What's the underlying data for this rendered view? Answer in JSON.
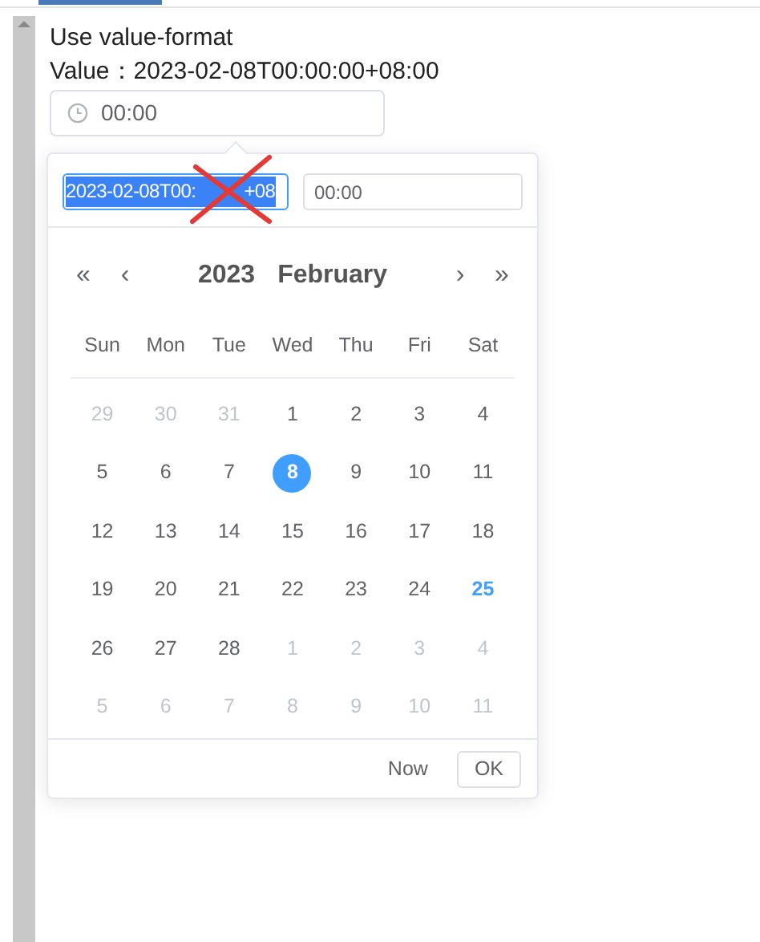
{
  "heading": "Use value-format",
  "value_label": "Value：",
  "value_text": "2023-02-08T00:00:00+08:00",
  "time_input": {
    "value": "00:00"
  },
  "picker": {
    "date_value_start": "2023-02-08T00:",
    "date_value_end": "+08",
    "date_value_selected": true,
    "time_value": "00:00",
    "nav": {
      "prev_year": "«",
      "prev_month": "‹",
      "next_month": "›",
      "next_year": "»"
    },
    "year": "2023",
    "month": "February",
    "weekdays": [
      "Sun",
      "Mon",
      "Tue",
      "Wed",
      "Thu",
      "Fri",
      "Sat"
    ],
    "days": [
      {
        "label": "29",
        "kind": "other",
        "selected": false,
        "today": false
      },
      {
        "label": "30",
        "kind": "other",
        "selected": false,
        "today": false
      },
      {
        "label": "31",
        "kind": "other",
        "selected": false,
        "today": false
      },
      {
        "label": "1",
        "kind": "current",
        "selected": false,
        "today": false
      },
      {
        "label": "2",
        "kind": "current",
        "selected": false,
        "today": false
      },
      {
        "label": "3",
        "kind": "current",
        "selected": false,
        "today": false
      },
      {
        "label": "4",
        "kind": "current",
        "selected": false,
        "today": false
      },
      {
        "label": "5",
        "kind": "current",
        "selected": false,
        "today": false
      },
      {
        "label": "6",
        "kind": "current",
        "selected": false,
        "today": false
      },
      {
        "label": "7",
        "kind": "current",
        "selected": false,
        "today": false
      },
      {
        "label": "8",
        "kind": "current",
        "selected": true,
        "today": false
      },
      {
        "label": "9",
        "kind": "current",
        "selected": false,
        "today": false
      },
      {
        "label": "10",
        "kind": "current",
        "selected": false,
        "today": false
      },
      {
        "label": "11",
        "kind": "current",
        "selected": false,
        "today": false
      },
      {
        "label": "12",
        "kind": "current",
        "selected": false,
        "today": false
      },
      {
        "label": "13",
        "kind": "current",
        "selected": false,
        "today": false
      },
      {
        "label": "14",
        "kind": "current",
        "selected": false,
        "today": false
      },
      {
        "label": "15",
        "kind": "current",
        "selected": false,
        "today": false
      },
      {
        "label": "16",
        "kind": "current",
        "selected": false,
        "today": false
      },
      {
        "label": "17",
        "kind": "current",
        "selected": false,
        "today": false
      },
      {
        "label": "18",
        "kind": "current",
        "selected": false,
        "today": false
      },
      {
        "label": "19",
        "kind": "current",
        "selected": false,
        "today": false
      },
      {
        "label": "20",
        "kind": "current",
        "selected": false,
        "today": false
      },
      {
        "label": "21",
        "kind": "current",
        "selected": false,
        "today": false
      },
      {
        "label": "22",
        "kind": "current",
        "selected": false,
        "today": false
      },
      {
        "label": "23",
        "kind": "current",
        "selected": false,
        "today": false
      },
      {
        "label": "24",
        "kind": "current",
        "selected": false,
        "today": false
      },
      {
        "label": "25",
        "kind": "current",
        "selected": false,
        "today": true
      },
      {
        "label": "26",
        "kind": "current",
        "selected": false,
        "today": false
      },
      {
        "label": "27",
        "kind": "current",
        "selected": false,
        "today": false
      },
      {
        "label": "28",
        "kind": "current",
        "selected": false,
        "today": false
      },
      {
        "label": "1",
        "kind": "other",
        "selected": false,
        "today": false
      },
      {
        "label": "2",
        "kind": "other",
        "selected": false,
        "today": false
      },
      {
        "label": "3",
        "kind": "other",
        "selected": false,
        "today": false
      },
      {
        "label": "4",
        "kind": "other",
        "selected": false,
        "today": false
      },
      {
        "label": "5",
        "kind": "other",
        "selected": false,
        "today": false
      },
      {
        "label": "6",
        "kind": "other",
        "selected": false,
        "today": false
      },
      {
        "label": "7",
        "kind": "other",
        "selected": false,
        "today": false
      },
      {
        "label": "8",
        "kind": "other",
        "selected": false,
        "today": false
      },
      {
        "label": "9",
        "kind": "other",
        "selected": false,
        "today": false
      },
      {
        "label": "10",
        "kind": "other",
        "selected": false,
        "today": false
      },
      {
        "label": "11",
        "kind": "other",
        "selected": false,
        "today": false
      }
    ],
    "footer": {
      "now": "Now",
      "ok": "OK"
    }
  }
}
